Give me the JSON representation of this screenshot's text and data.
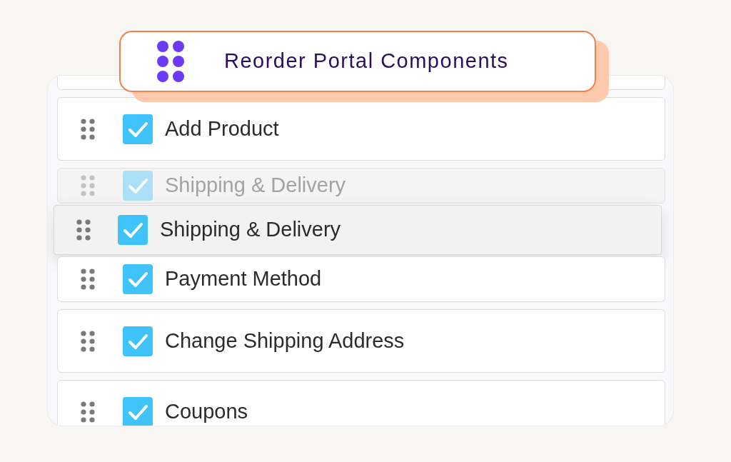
{
  "header": {
    "title": "Reorder Portal Components"
  },
  "rows": [
    {
      "kind": "item",
      "label": "Add Product",
      "checked": true
    },
    {
      "kind": "placeholder",
      "label": "Shipping & Delivery",
      "checked": true
    },
    {
      "kind": "item",
      "label": "Payment Method",
      "checked": true
    },
    {
      "kind": "item",
      "label": "Change Shipping Address",
      "checked": true
    },
    {
      "kind": "item",
      "label": "Coupons",
      "checked": true
    }
  ],
  "dragged": {
    "label": "Shipping & Delivery",
    "checked": true
  }
}
